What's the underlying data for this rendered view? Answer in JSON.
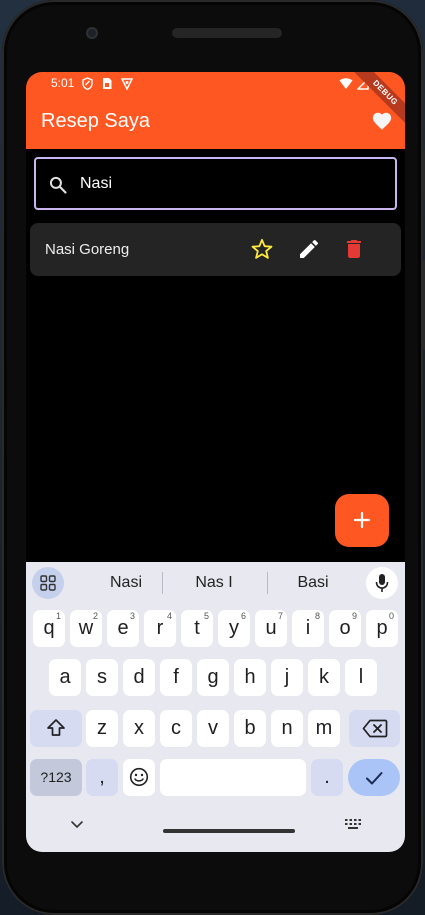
{
  "status_bar": {
    "time": "5:01"
  },
  "app_bar": {
    "title": "Resep Saya",
    "debug_label": "DEBUG"
  },
  "search": {
    "value": "Nasi"
  },
  "recipes": [
    {
      "name": "Nasi Goreng"
    }
  ],
  "keyboard": {
    "suggestions": [
      "Nasi",
      "Nas I",
      "Basi"
    ],
    "row1": [
      {
        "label": "q",
        "hint": "1"
      },
      {
        "label": "w",
        "hint": "2"
      },
      {
        "label": "e",
        "hint": "3"
      },
      {
        "label": "r",
        "hint": "4"
      },
      {
        "label": "t",
        "hint": "5"
      },
      {
        "label": "y",
        "hint": "6"
      },
      {
        "label": "u",
        "hint": "7"
      },
      {
        "label": "i",
        "hint": "8"
      },
      {
        "label": "o",
        "hint": "9"
      },
      {
        "label": "p",
        "hint": "0"
      }
    ],
    "row2": [
      "a",
      "s",
      "d",
      "f",
      "g",
      "h",
      "j",
      "k",
      "l"
    ],
    "row3": [
      "z",
      "x",
      "c",
      "v",
      "b",
      "n",
      "m"
    ],
    "symbols_label": "?123",
    "comma_label": ",",
    "period_label": "."
  },
  "colors": {
    "primary": "#ff5722",
    "delete": "#e53935",
    "star": "#ffeb3b",
    "search_border": "#c9b6f0",
    "keyboard_bg": "#e8e9f0"
  },
  "icons": [
    "search-icon",
    "heart-icon",
    "star-outline-icon",
    "edit-pencil-icon",
    "delete-trash-icon",
    "plus-icon",
    "grid-icon",
    "mic-icon",
    "shift-icon",
    "backspace-icon",
    "emoji-icon",
    "enter-check-icon",
    "chevron-down-icon",
    "keyboard-icon"
  ]
}
